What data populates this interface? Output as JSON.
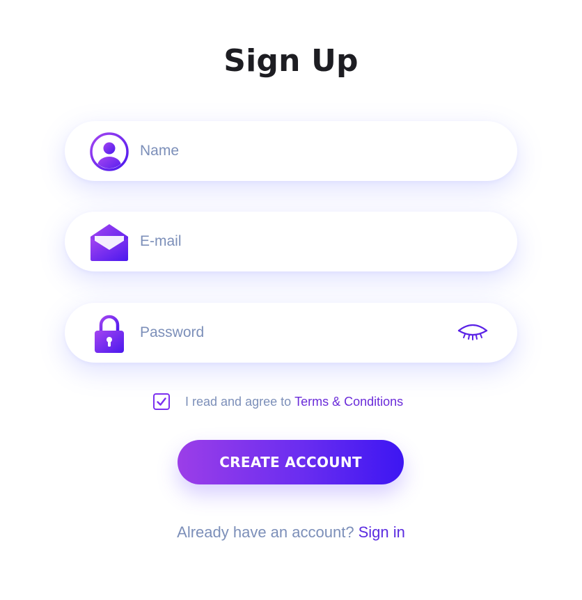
{
  "title": "Sign Up",
  "fields": {
    "name": {
      "label": "Name",
      "icon": "user-icon"
    },
    "email": {
      "label": "E-mail",
      "icon": "envelope-icon"
    },
    "password": {
      "label": "Password",
      "icon": "lock-icon",
      "toggle_icon": "eye-closed-icon"
    }
  },
  "terms": {
    "checked": true,
    "text": "I read and agree to",
    "link": "Terms & Conditions"
  },
  "create_button": "CREATE ACCOUNT",
  "signin": {
    "prompt": "Already have an account?",
    "link": "Sign in"
  },
  "colors": {
    "accent": "#7b2ff0",
    "gradient_start": "#9b3ee8",
    "gradient_end": "#3d16f2",
    "muted_text": "#7c8fb9",
    "title": "#1d1d22"
  }
}
